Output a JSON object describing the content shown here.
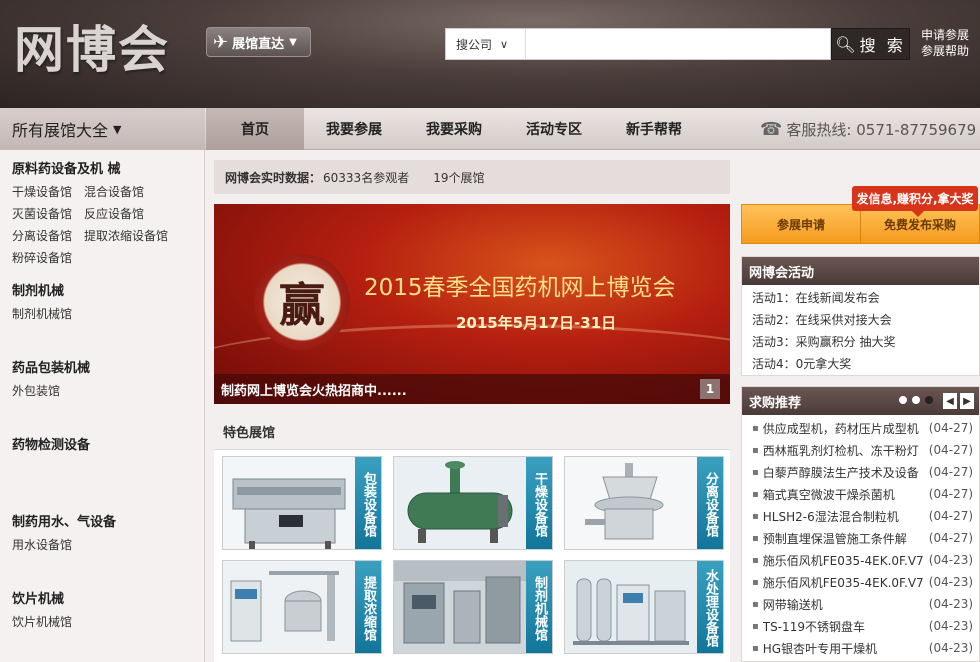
{
  "header": {
    "logo": "网博会",
    "hall_button": "展馆直达",
    "search": {
      "select": "搜公司",
      "placeholder": "",
      "button": "搜 索"
    },
    "links": [
      "申请参展",
      "参展帮助"
    ]
  },
  "nav": {
    "all_halls": "所有展馆大全",
    "items": [
      "首页",
      "我要参展",
      "我要采购",
      "活动专区",
      "新手帮帮"
    ],
    "hotline": "客服热线: 0571-87759679"
  },
  "sidebar": {
    "categories": [
      {
        "title": "原料药设备及机 械",
        "links": [
          "干燥设备馆",
          "混合设备馆",
          "灭菌设备馆",
          "反应设备馆",
          "分离设备馆",
          "提取浓缩设备馆",
          "粉碎设备馆"
        ]
      },
      {
        "title": "制剂机械",
        "links": [
          "制剂机械馆"
        ]
      },
      {
        "title": "药品包装机械",
        "links": [
          "外包装馆"
        ]
      },
      {
        "title": "药物检测设备",
        "links": []
      },
      {
        "title": "制药用水、气设备",
        "links": [
          "用水设备馆"
        ]
      },
      {
        "title": "饮片机械",
        "links": [
          "饮片机械馆"
        ]
      }
    ]
  },
  "stats": {
    "label": "网博会实时数据：",
    "visitors": "60333名参观者",
    "halls": "19个展馆"
  },
  "banner": {
    "drum_char": "赢",
    "title": "2015春季全国药机网上博览会",
    "date": "2015年5月17日-31日",
    "caption": "制药网上博览会火热招商中......",
    "page": "1"
  },
  "featured": {
    "title": "特色展馆",
    "tiles": [
      {
        "label": "包装设备馆",
        "icon": "packaging-machine-photo"
      },
      {
        "label": "干燥设备馆",
        "icon": "drying-tank-photo"
      },
      {
        "label": "分离设备馆",
        "icon": "separator-photo"
      },
      {
        "label": "提取浓缩馆",
        "icon": "extraction-unit-photo"
      },
      {
        "label": "制剂机械馆",
        "icon": "pharma-machinery-photo"
      },
      {
        "label": "水处理设备馆",
        "icon": "water-treatment-photo"
      }
    ]
  },
  "right": {
    "promo_tag": "发信息,赚积分,拿大奖",
    "apply": [
      "参展申请",
      "免费发布采购"
    ],
    "activities": {
      "title": "网博会活动",
      "items": [
        "活动1：在线新闻发布会",
        "活动2：在线采供对接大会",
        "活动3：采购赢积分 抽大奖",
        "活动4：0元拿大奖"
      ]
    },
    "purchases": {
      "title": "求购推荐",
      "items": [
        {
          "name": "供应成型机，药材压片成型机",
          "date": "(04-27)"
        },
        {
          "name": "西林瓶乳剂灯检机、冻干粉灯",
          "date": "(04-27)"
        },
        {
          "name": "白藜芦醇膜法生产技术及设备",
          "date": "(04-27)"
        },
        {
          "name": "箱式真空微波干燥杀菌机",
          "date": "(04-27)"
        },
        {
          "name": "HLSH2-6湿法混合制粒机",
          "date": "(04-27)"
        },
        {
          "name": "预制直埋保温管施工条件解",
          "date": "(04-27)"
        },
        {
          "name": "施乐佰风机FE035-4EK.0F.V7",
          "date": "(04-23)"
        },
        {
          "name": "施乐佰风机FE035-4EK.0F.V7",
          "date": "(04-23)"
        },
        {
          "name": "网带输送机",
          "date": "(04-23)"
        },
        {
          "name": "TS-119不锈钢盘车",
          "date": "(04-23)"
        },
        {
          "name": "HG银杏叶专用干燥机",
          "date": "(04-23)"
        }
      ]
    }
  },
  "colors": {
    "accent": "#f59a1c",
    "banner_red": "#b51f10",
    "tile_strip": "#11759a",
    "promo": "#d8341a"
  }
}
